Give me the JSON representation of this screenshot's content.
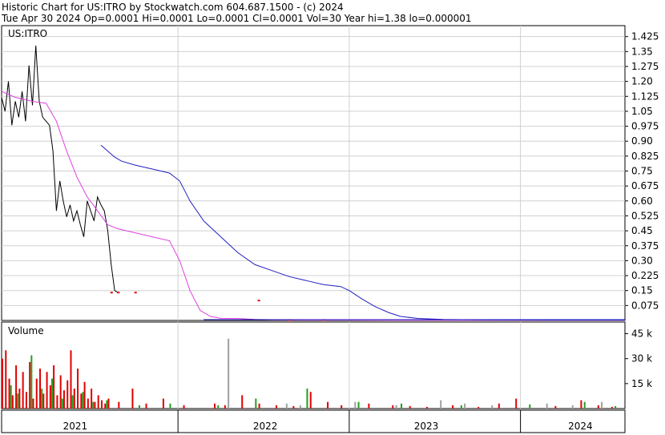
{
  "header": {
    "line1": "Historic Chart for US:ITRO by Stockwatch.com 604.687.1500 - (c) 2024",
    "line2": "Tue Apr 30 2024  Op=0.0001  Hi=0.0001  Lo=0.0001  Cl=0.0001  Vol=30  Year hi=1.38  lo=0.000001"
  },
  "colors": {
    "price": "#000000",
    "ma_short": "#e040e0",
    "ma_long": "#2020c0",
    "grid": "#d0d0d0",
    "volume_up": "#20a020",
    "volume_down": "#e00000",
    "volume_spike": "#a0a0a0",
    "price_low_points": "#e00000"
  },
  "chart_data": [
    {
      "type": "line",
      "title": "US:ITRO",
      "ylim": [
        0,
        1.48
      ],
      "yticks": [
        "1.425",
        "1.35",
        "1.275",
        "1.20",
        "1.125",
        "1.05",
        "0.975",
        "0.90",
        "0.825",
        "0.75",
        "0.675",
        "0.60",
        "0.525",
        "0.45",
        "0.375",
        "0.30",
        "0.225",
        "0.15",
        "0.075"
      ],
      "ytick_values": [
        1.425,
        1.35,
        1.275,
        1.2,
        1.125,
        1.05,
        0.975,
        0.9,
        0.825,
        0.75,
        0.675,
        0.6,
        0.525,
        0.45,
        0.375,
        0.3,
        0.225,
        0.15,
        0.075
      ],
      "xlim": [
        2020.72,
        2024.36
      ],
      "year_dividers": [
        2021.75,
        2022.75,
        2023.75
      ],
      "xticks": [
        {
          "label": "2021",
          "x": 2021.15
        },
        {
          "label": "2022",
          "x": 2022.26
        },
        {
          "label": "2023",
          "x": 2023.2
        },
        {
          "label": "2024",
          "x": 2024.1
        }
      ],
      "series": [
        {
          "role": "price",
          "x": [
            2020.72,
            2020.74,
            2020.76,
            2020.78,
            2020.8,
            2020.82,
            2020.84,
            2020.86,
            2020.88,
            2020.9,
            2020.92,
            2020.94,
            2020.96,
            2020.98,
            2021.0,
            2021.02,
            2021.04,
            2021.06,
            2021.08,
            2021.1,
            2021.12,
            2021.14,
            2021.16,
            2021.18,
            2021.2,
            2021.22,
            2021.24,
            2021.26,
            2021.28,
            2021.3,
            2021.32,
            2021.34,
            2021.36,
            2021.38,
            2021.4
          ],
          "values": [
            1.12,
            1.05,
            1.2,
            0.98,
            1.1,
            1.02,
            1.15,
            1.0,
            1.28,
            1.08,
            1.38,
            1.1,
            1.02,
            1.0,
            0.98,
            0.85,
            0.55,
            0.7,
            0.6,
            0.52,
            0.58,
            0.5,
            0.55,
            0.48,
            0.42,
            0.6,
            0.55,
            0.5,
            0.62,
            0.58,
            0.55,
            0.45,
            0.28,
            0.15,
            0.14
          ]
        },
        {
          "role": "ma_short",
          "x": [
            2020.72,
            2020.8,
            2020.9,
            2020.98,
            2021.04,
            2021.1,
            2021.16,
            2021.22,
            2021.28,
            2021.34,
            2021.4,
            2021.5,
            2021.6,
            2021.7,
            2021.76,
            2021.82,
            2021.88,
            2021.94,
            2022.0,
            2022.05,
            2022.1,
            2022.2,
            2022.3,
            2022.5,
            2022.75,
            2023.0,
            2023.5,
            2024.0,
            2024.36
          ],
          "values": [
            1.15,
            1.12,
            1.1,
            1.09,
            1.0,
            0.85,
            0.72,
            0.62,
            0.55,
            0.48,
            0.46,
            0.44,
            0.42,
            0.4,
            0.3,
            0.15,
            0.05,
            0.02,
            0.01,
            0.01,
            0.01,
            0.005,
            0.003,
            0.002,
            0.002,
            0.001,
            0.001,
            0.001,
            0.001
          ]
        },
        {
          "role": "ma_long",
          "x": [
            2021.3,
            2021.34,
            2021.38,
            2021.42,
            2021.5,
            2021.6,
            2021.7,
            2021.76,
            2021.82,
            2021.9,
            2022.0,
            2022.1,
            2022.2,
            2022.3,
            2022.4,
            2022.5,
            2022.6,
            2022.7,
            2022.75,
            2022.82,
            2022.9,
            2022.98,
            2023.05,
            2023.15,
            2023.3,
            2023.5,
            2024.0,
            2024.36
          ],
          "values": [
            0.88,
            0.85,
            0.82,
            0.8,
            0.78,
            0.76,
            0.74,
            0.7,
            0.6,
            0.5,
            0.42,
            0.34,
            0.28,
            0.25,
            0.22,
            0.2,
            0.18,
            0.17,
            0.15,
            0.11,
            0.07,
            0.04,
            0.02,
            0.01,
            0.005,
            0.003,
            0.002,
            0.002
          ]
        },
        {
          "role": "price_low_points",
          "x": [
            2021.36,
            2021.4,
            2021.5,
            2022.22,
            2022.4,
            2022.6
          ],
          "values": [
            0.14,
            0.14,
            0.14,
            0.1,
            0.002,
            0.002
          ]
        }
      ]
    },
    {
      "type": "bar",
      "title": "Volume",
      "ylim": [
        0,
        52000
      ],
      "yticks": [
        "45 k",
        "30 k",
        "15 k"
      ],
      "ytick_values": [
        45000,
        30000,
        15000
      ],
      "xlim": [
        2020.72,
        2024.36
      ],
      "year_dividers": [
        2021.75,
        2022.75,
        2023.75
      ],
      "series": [
        {
          "role": "down",
          "x": [
            2020.72,
            2020.74,
            2020.76,
            2020.78,
            2020.8,
            2020.82,
            2020.84,
            2020.86,
            2020.88,
            2020.9,
            2020.92,
            2020.94,
            2020.96,
            2020.98,
            2021.0,
            2021.02,
            2021.04,
            2021.06,
            2021.08,
            2021.1,
            2021.12,
            2021.14,
            2021.16,
            2021.18,
            2021.2,
            2021.22,
            2021.24,
            2021.26,
            2021.28,
            2021.3,
            2021.32,
            2021.34,
            2021.4,
            2021.48,
            2021.56,
            2021.66,
            2021.78,
            2021.96,
            2022.02,
            2022.12,
            2022.22,
            2022.32,
            2022.42,
            2022.52,
            2022.62,
            2022.7,
            2022.86,
            2023.0,
            2023.1,
            2023.2,
            2023.35,
            2023.5,
            2023.62,
            2023.72,
            2023.95,
            2024.1,
            2024.2,
            2024.28
          ],
          "values": [
            30000,
            35000,
            18000,
            8000,
            26000,
            12000,
            22000,
            10000,
            28000,
            6000,
            18000,
            24000,
            9000,
            22000,
            14000,
            26000,
            8000,
            20000,
            11000,
            17000,
            35000,
            12000,
            24000,
            9000,
            16000,
            6000,
            12000,
            4000,
            8000,
            5000,
            3000,
            6000,
            4000,
            12000,
            3000,
            6000,
            2000,
            3000,
            2000,
            8000,
            3000,
            2000,
            1500,
            10000,
            4000,
            2000,
            3000,
            2000,
            1500,
            1000,
            2000,
            1000,
            3000,
            6000,
            1500,
            5000,
            2000,
            1000
          ]
        },
        {
          "role": "up",
          "x": [
            2020.77,
            2020.81,
            2020.89,
            2020.95,
            2021.01,
            2021.07,
            2021.13,
            2021.19,
            2021.25,
            2021.33,
            2021.52,
            2021.7,
            2021.98,
            2022.2,
            2022.5,
            2022.8,
            2023.05,
            2023.4,
            2023.8,
            2024.12,
            2024.3
          ],
          "values": [
            14000,
            9000,
            32000,
            12000,
            18000,
            6000,
            8000,
            10000,
            4000,
            5000,
            2000,
            3000,
            2000,
            6000,
            12000,
            4000,
            3000,
            2000,
            2500,
            4000,
            1500
          ]
        },
        {
          "role": "spike",
          "x": [
            2022.04,
            2022.38,
            2022.46,
            2022.78,
            2023.02,
            2023.28,
            2023.42,
            2023.58,
            2023.9,
            2024.05,
            2024.22
          ],
          "values": [
            42000,
            3000,
            2000,
            4000,
            2000,
            5000,
            3000,
            2000,
            3000,
            2000,
            4000
          ]
        }
      ]
    }
  ]
}
